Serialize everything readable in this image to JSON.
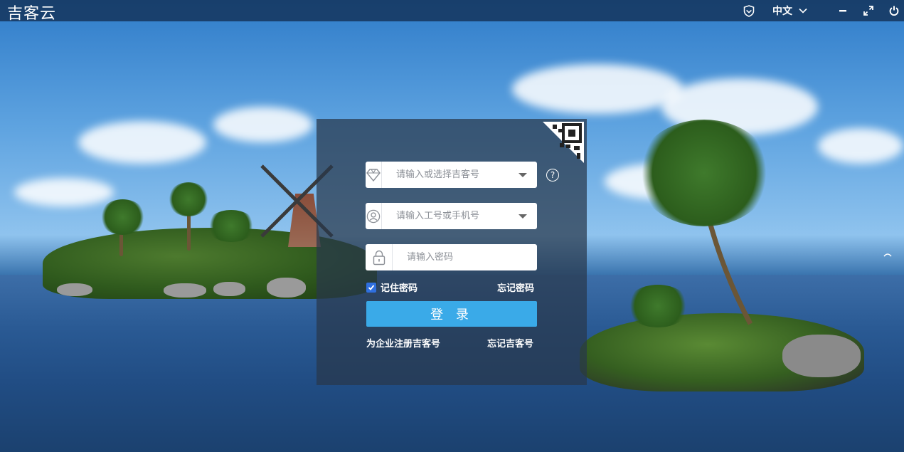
{
  "app": {
    "title": "吉客云"
  },
  "titlebar": {
    "language": "中文",
    "icons": [
      "shield-icon",
      "chevron-down-icon",
      "minimize-icon",
      "maximize-icon",
      "power-icon"
    ]
  },
  "login": {
    "account_placeholder": "请输入或选择吉客号",
    "user_placeholder": "请输入工号或手机号",
    "password_placeholder": "请输入密码",
    "remember_label": "记住密码",
    "remember_checked": true,
    "forgot_password": "忘记密码",
    "login_button": "登 录",
    "register_link": "为企业注册吉客号",
    "forgot_account": "忘记吉客号",
    "help_symbol": "?"
  },
  "colors": {
    "accent": "#3aaae8",
    "checkbox": "#2f6fde",
    "titlebar": "#14325a"
  }
}
